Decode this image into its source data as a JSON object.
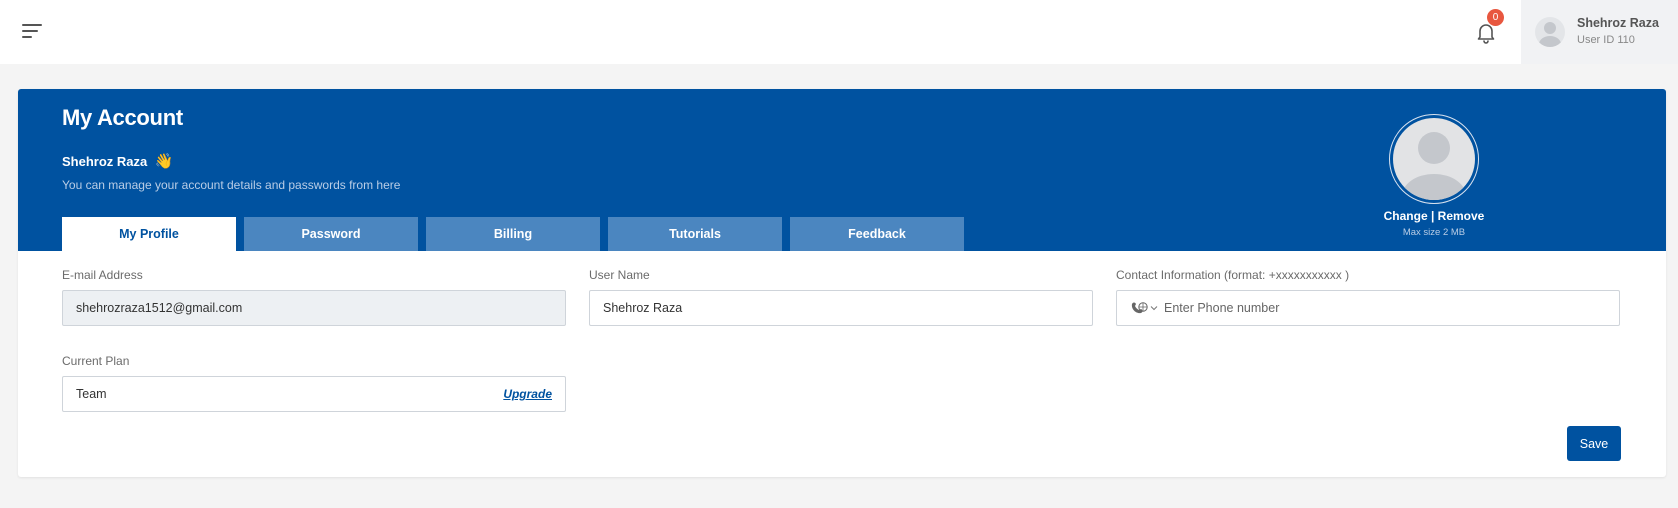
{
  "header": {
    "notifications_count": "0",
    "user": {
      "name": "Shehroz Raza",
      "id_label": "User ID 110"
    }
  },
  "account": {
    "title": "My Account",
    "greeting_name": "Shehroz Raza",
    "wave_emoji": "👋",
    "subtitle": "You can manage your account details and passwords from here",
    "tabs": [
      {
        "label": "My Profile",
        "active": true
      },
      {
        "label": "Password",
        "active": false
      },
      {
        "label": "Billing",
        "active": false
      },
      {
        "label": "Tutorials",
        "active": false
      },
      {
        "label": "Feedback",
        "active": false
      }
    ],
    "avatar": {
      "change_label": "Change",
      "separator": " | ",
      "remove_label": "Remove",
      "max_size": "Max size 2 MB"
    }
  },
  "form": {
    "email": {
      "label": "E-mail Address",
      "value": "shehrozraza1512@gmail.com"
    },
    "username": {
      "label": "User Name",
      "value": "Shehroz Raza"
    },
    "contact": {
      "label": "Contact Information (format: +xxxxxxxxxxx )",
      "placeholder": "Enter Phone number"
    },
    "plan": {
      "label": "Current Plan",
      "value": "Team",
      "upgrade_label": "Upgrade"
    },
    "save_label": "Save"
  },
  "colors": {
    "brand": "#0052a0",
    "tab_inactive": "#4b86c0",
    "badge": "#e8573f"
  }
}
